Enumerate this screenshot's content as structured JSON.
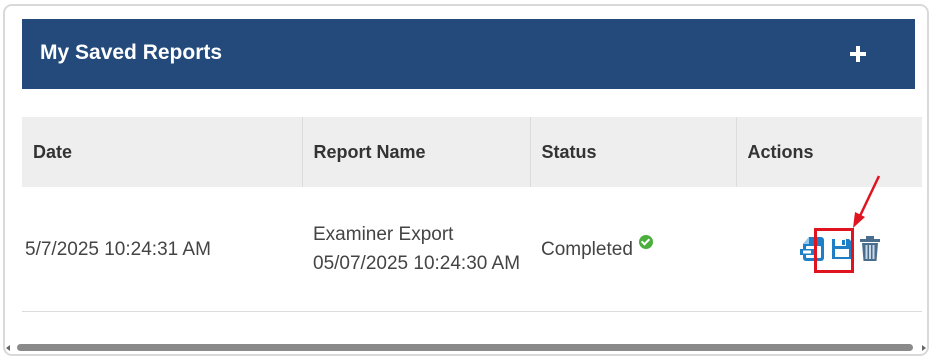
{
  "panel": {
    "title": "My Saved Reports",
    "add_label": "+"
  },
  "table": {
    "headers": [
      "Date",
      "Report Name",
      "Status",
      "Actions"
    ],
    "rows": [
      {
        "date": "5/7/2025 10:24:31 AM",
        "report_name": "Examiner Export 05/07/2025 10:24:30 AM",
        "status": "Completed",
        "actions": [
          "view-report-icon",
          "save-icon",
          "trash-icon"
        ]
      }
    ]
  },
  "colors": {
    "header_bg": "#234a7a",
    "action_blue": "#1f7fc6",
    "status_green": "#4cae3d",
    "highlight_red": "#e0141e"
  }
}
